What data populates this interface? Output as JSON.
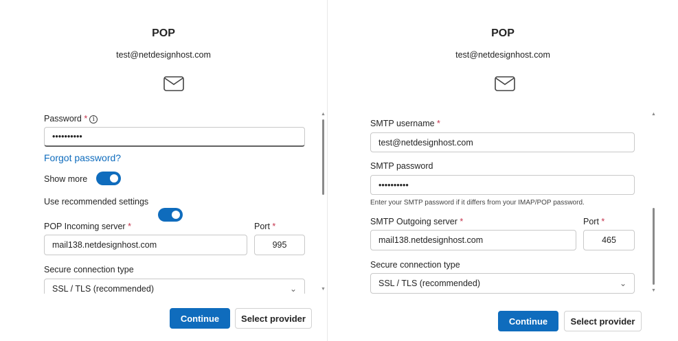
{
  "left": {
    "title": "POP",
    "email": "test@netdesignhost.com",
    "icon": "mail-icon",
    "password_label": "Password",
    "required_mark": "*",
    "info_glyph": "i",
    "password_value": "••••••••••",
    "forgot_password": "Forgot password?",
    "show_more_label": "Show more",
    "show_more_on": true,
    "use_recommended_label": "Use recommended settings",
    "use_recommended_on": true,
    "incoming_server_label": "POP Incoming server",
    "incoming_server_value": "mail138.netdesignhost.com",
    "port_label": "Port",
    "port_value": "995",
    "secure_label": "Secure connection type",
    "secure_value": "SSL / TLS (recommended)",
    "continue_button": "Continue",
    "select_provider_button": "Select provider"
  },
  "right": {
    "title": "POP",
    "email": "test@netdesignhost.com",
    "icon": "mail-icon",
    "smtp_username_label": "SMTP username",
    "required_mark": "*",
    "smtp_username_value": "test@netdesignhost.com",
    "smtp_password_label": "SMTP password",
    "smtp_password_value": "••••••••••",
    "smtp_password_hint": "Enter your SMTP password if it differs from your IMAP/POP password.",
    "outgoing_server_label": "SMTP Outgoing server",
    "outgoing_server_value": "mail138.netdesignhost.com",
    "port_label": "Port",
    "port_value": "465",
    "secure_label": "Secure connection type",
    "secure_value": "SSL / TLS (recommended)",
    "continue_button": "Continue",
    "select_provider_button": "Select provider"
  },
  "colors": {
    "accent": "#0f6cbd",
    "required": "#c4314b",
    "text": "#242424",
    "divider": "#e8e8e8"
  }
}
